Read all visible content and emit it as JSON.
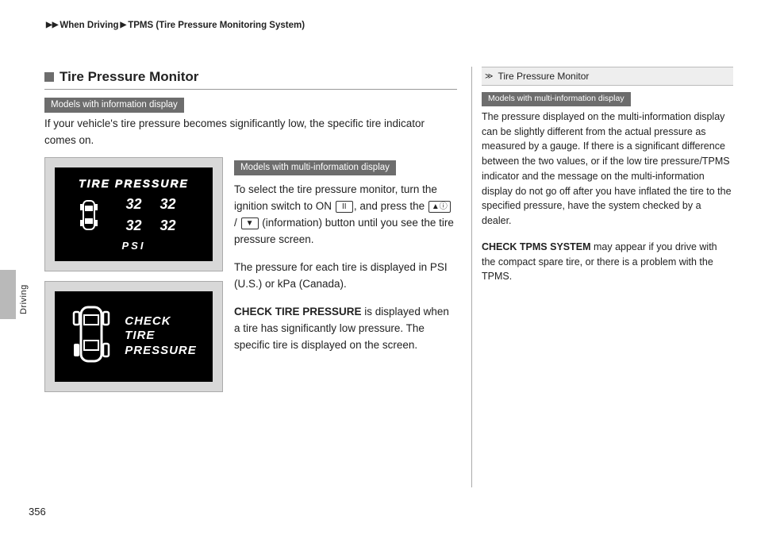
{
  "breadcrumb": {
    "lvl1": "When Driving",
    "lvl2": "TPMS (Tire Pressure Monitoring System)"
  },
  "page_number": "356",
  "side_tab": "Driving",
  "heading": "Tire Pressure Monitor",
  "tag_info": "Models with information display",
  "tag_multi": "Models with multi-information display",
  "intro": "If your vehicle's tire pressure becomes significantly low, the specific tire indicator comes on.",
  "display1": {
    "title": "TIRE PRESSURE",
    "fl": "32",
    "fr": "32",
    "rl": "32",
    "rr": "32",
    "unit": "PSI"
  },
  "display2": {
    "line1": "CHECK",
    "line2": "TIRE",
    "line3": "PRESSURE"
  },
  "right_col": {
    "p1a": "To select the tire pressure monitor, turn the ignition switch to ON ",
    "p1b": ", and press the ",
    "p1c": " / ",
    "p1d": " (information) button until you see the tire pressure screen.",
    "p2": "The pressure for each tire is displayed in PSI (U.S.) or kPa (Canada).",
    "p3_bold": "CHECK TIRE PRESSURE",
    "p3_rest": " is displayed when a tire has significantly low pressure. The specific tire is displayed on the screen."
  },
  "sidebar": {
    "title": "Tire Pressure Monitor",
    "tag": "Models with multi-information display",
    "p1": "The pressure displayed on the multi-information display can be slightly different from the actual pressure as measured by a gauge. If there is a significant difference between the two values, or if the low tire pressure/TPMS indicator and the message on the multi-information display do not go off after you have inflated the tire to the specified pressure, have the system checked by a dealer.",
    "p2_bold": "CHECK TPMS SYSTEM",
    "p2_rest": " may appear if you drive with the compact spare tire, or there is a problem with the TPMS."
  },
  "icons": {
    "on": "II",
    "up": "▲ⓘ",
    "down": "▼"
  }
}
